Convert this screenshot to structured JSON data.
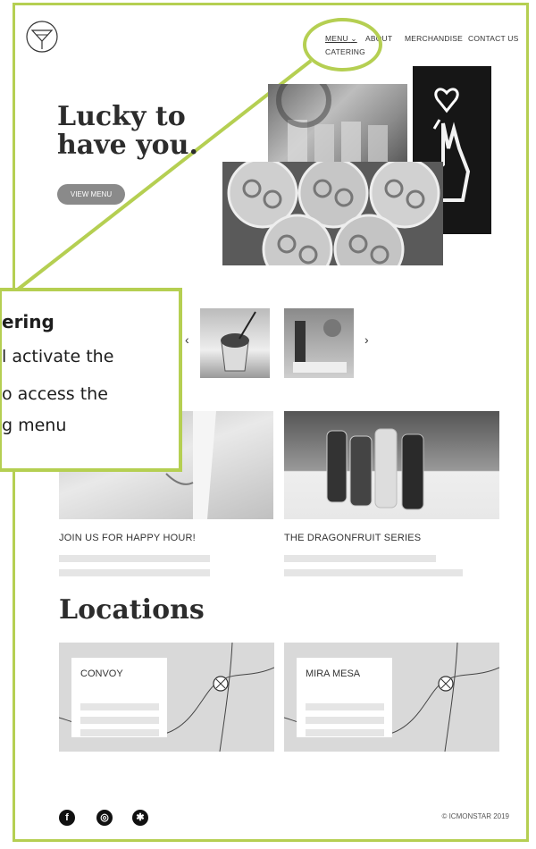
{
  "nav": {
    "menu": "MENU",
    "menu_caret": "⌄",
    "about": "ABOUT",
    "merchandise": "MERCHANDISE",
    "contact": "CONTACT US",
    "catering": "CATERING"
  },
  "hero": {
    "title_line1": "Lucky to",
    "title_line2": "have you.",
    "button": "VIEW MENU"
  },
  "carousel": {
    "prev": "‹",
    "next": "›"
  },
  "cards": [
    {
      "title": "JOIN US FOR HAPPY HOUR!"
    },
    {
      "title": "THE DRAGONFRUIT SERIES"
    }
  ],
  "locations": {
    "heading": "Locations",
    "items": [
      {
        "name": "CONVOY"
      },
      {
        "name": "MIRA MESA"
      }
    ]
  },
  "footer": {
    "social_facebook": "f",
    "social_instagram": "◎",
    "social_yelp": "✱",
    "copyright": "© ICMONSTAR 2019"
  },
  "callout": {
    "title": "ering",
    "line1": "l activate the",
    "line2": "o access the",
    "line3": "g menu"
  },
  "colors": {
    "accent": "#b5cf52",
    "button": "#8a8a8a",
    "placeholder": "#e5e5e5",
    "map": "#d9d9d9"
  }
}
